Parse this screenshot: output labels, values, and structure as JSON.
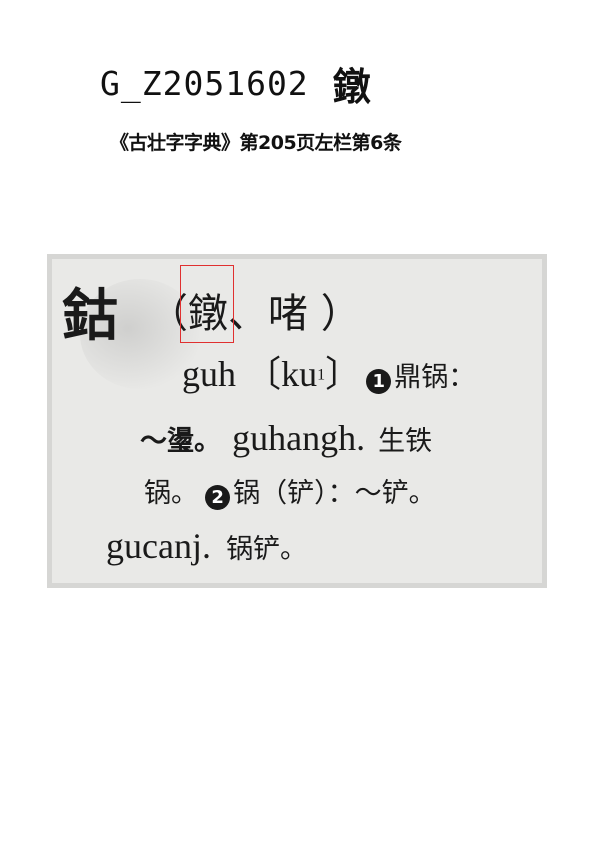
{
  "header": {
    "code": "G_Z2051602",
    "character": "鐓",
    "source": "《古壮字字典》第205页左栏第6条"
  },
  "dictionary_entry": {
    "headword": "鈷",
    "open_paren": "（",
    "variant_highlighted": "鐓",
    "variants_rest": "、啫 ）",
    "pronunciation": "guh",
    "phonetic_open": "〔ku",
    "phonetic_tone": "1",
    "phonetic_close": "〕",
    "sense1_marker": "1",
    "sense1_gloss": "鼎锅：",
    "example1_tilde": "～璗。",
    "example1_word": "guhangh.",
    "example1_gloss_a": "生铁",
    "example1_gloss_b": "锅。",
    "sense2_marker": "2",
    "sense2_gloss": "锅（铲）：～铲。",
    "example2_word": "gucanj.",
    "example2_gloss": "锅铲。"
  }
}
